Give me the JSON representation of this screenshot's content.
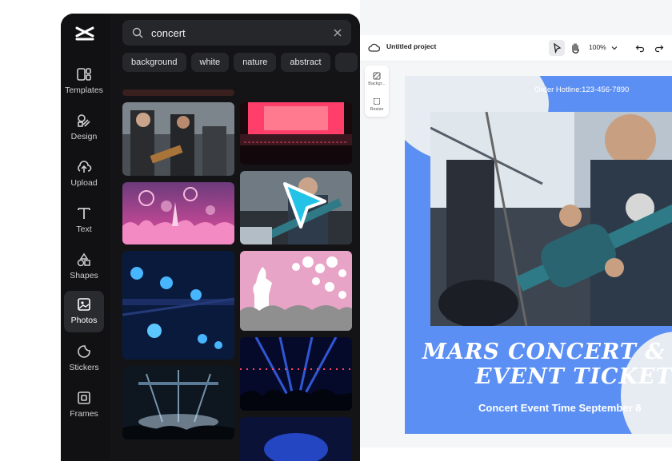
{
  "nav": {
    "items": [
      {
        "label": "Templates",
        "icon": "templates-icon"
      },
      {
        "label": "Design",
        "icon": "design-icon"
      },
      {
        "label": "Upload",
        "icon": "upload-icon"
      },
      {
        "label": "Text",
        "icon": "text-icon"
      },
      {
        "label": "Shapes",
        "icon": "shapes-icon"
      },
      {
        "label": "Photos",
        "icon": "photos-icon",
        "active": true
      },
      {
        "label": "Stickers",
        "icon": "stickers-icon"
      },
      {
        "label": "Frames",
        "icon": "frames-icon"
      }
    ]
  },
  "search": {
    "value": "concert"
  },
  "chips": [
    "background",
    "white",
    "nature",
    "abstract"
  ],
  "editor": {
    "project_title": "Untitled project",
    "zoom": "100%",
    "side_tools": [
      "Backgr...",
      "Resize"
    ]
  },
  "poster": {
    "hotline": "Order Hotline:123-456-7890",
    "title_line1": "MARS CONCERT &",
    "title_line2": "EVENT TICKET",
    "subline": "Concert Event Time September 8"
  },
  "colors": {
    "accent": "#5b8ff3",
    "cursor": "#22c3e6",
    "panel_bg": "#141416"
  }
}
